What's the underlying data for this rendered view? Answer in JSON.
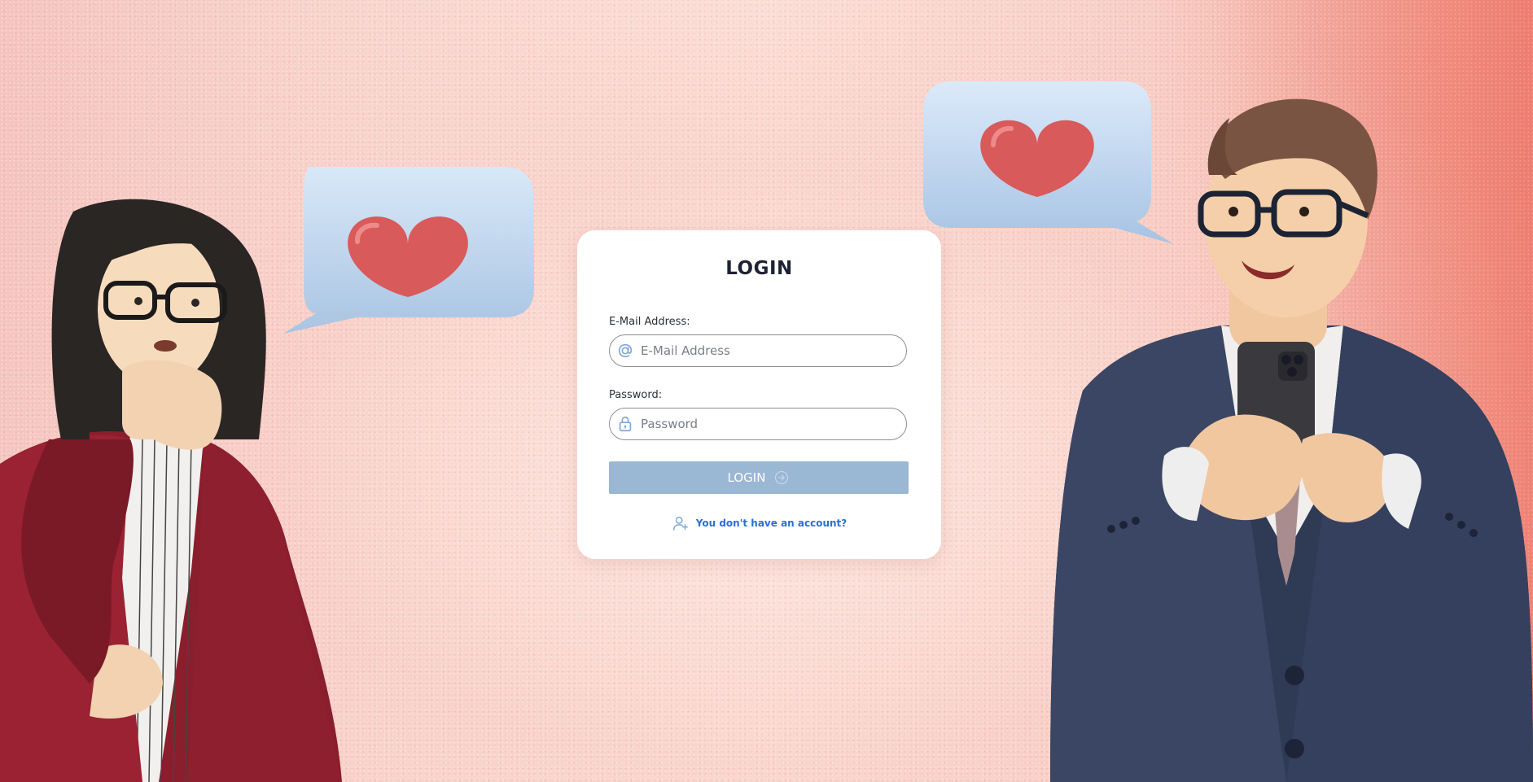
{
  "login": {
    "title": "LOGIN",
    "email_label": "E-Mail Address:",
    "email_placeholder": "E-Mail Address",
    "email_value": "",
    "password_label": "Password:",
    "password_placeholder": "Password",
    "password_value": "",
    "submit_label": "LOGIN",
    "register_link": "You don't have an account?"
  },
  "colors": {
    "button": "#9ab7d4",
    "link": "#2a6fd6",
    "icon": "#7fa6d6",
    "heart": "#d95a5a",
    "bubble": "#c6dcf3"
  },
  "icons": {
    "email": "at-sign-icon",
    "password": "lock-icon",
    "submit": "arrow-right-circle-icon",
    "register": "user-plus-icon"
  }
}
